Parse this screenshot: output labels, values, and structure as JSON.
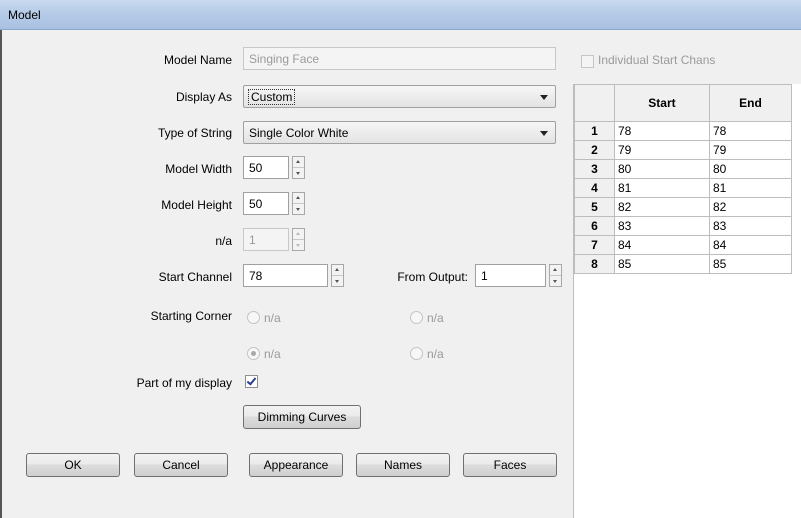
{
  "window": {
    "title": "Model"
  },
  "form": {
    "model_name": {
      "label": "Model Name",
      "value": "Singing Face"
    },
    "display_as": {
      "label": "Display As",
      "value": "Custom"
    },
    "type_of_string": {
      "label": "Type of String",
      "value": "Single Color White"
    },
    "model_width": {
      "label": "Model Width",
      "value": "50"
    },
    "model_height": {
      "label": "Model Height",
      "value": "50"
    },
    "na_field": {
      "label": "n/a",
      "value": "1"
    },
    "start_channel": {
      "label": "Start Channel",
      "value": "78"
    },
    "from_output": {
      "label": "From Output:",
      "value": "1"
    },
    "starting_corner": {
      "label": "Starting Corner",
      "options": [
        {
          "label": "n/a",
          "selected": false
        },
        {
          "label": "n/a",
          "selected": false
        },
        {
          "label": "n/a",
          "selected": true
        },
        {
          "label": "n/a",
          "selected": false
        }
      ]
    },
    "part_of_display": {
      "label": "Part of my display",
      "checked": true
    },
    "dimming_curves_label": "Dimming Curves"
  },
  "buttons": {
    "ok": "OK",
    "cancel": "Cancel",
    "appearance": "Appearance",
    "names": "Names",
    "faces": "Faces"
  },
  "channels": {
    "individual_label": "Individual Start Chans",
    "individual_checked": false,
    "headers": [
      "Start",
      "End"
    ],
    "rows": [
      {
        "num": "1",
        "start": "78",
        "end": "78"
      },
      {
        "num": "2",
        "start": "79",
        "end": "79"
      },
      {
        "num": "3",
        "start": "80",
        "end": "80"
      },
      {
        "num": "4",
        "start": "81",
        "end": "81"
      },
      {
        "num": "5",
        "start": "82",
        "end": "82"
      },
      {
        "num": "6",
        "start": "83",
        "end": "83"
      },
      {
        "num": "7",
        "start": "84",
        "end": "84"
      },
      {
        "num": "8",
        "start": "85",
        "end": "85"
      }
    ]
  }
}
